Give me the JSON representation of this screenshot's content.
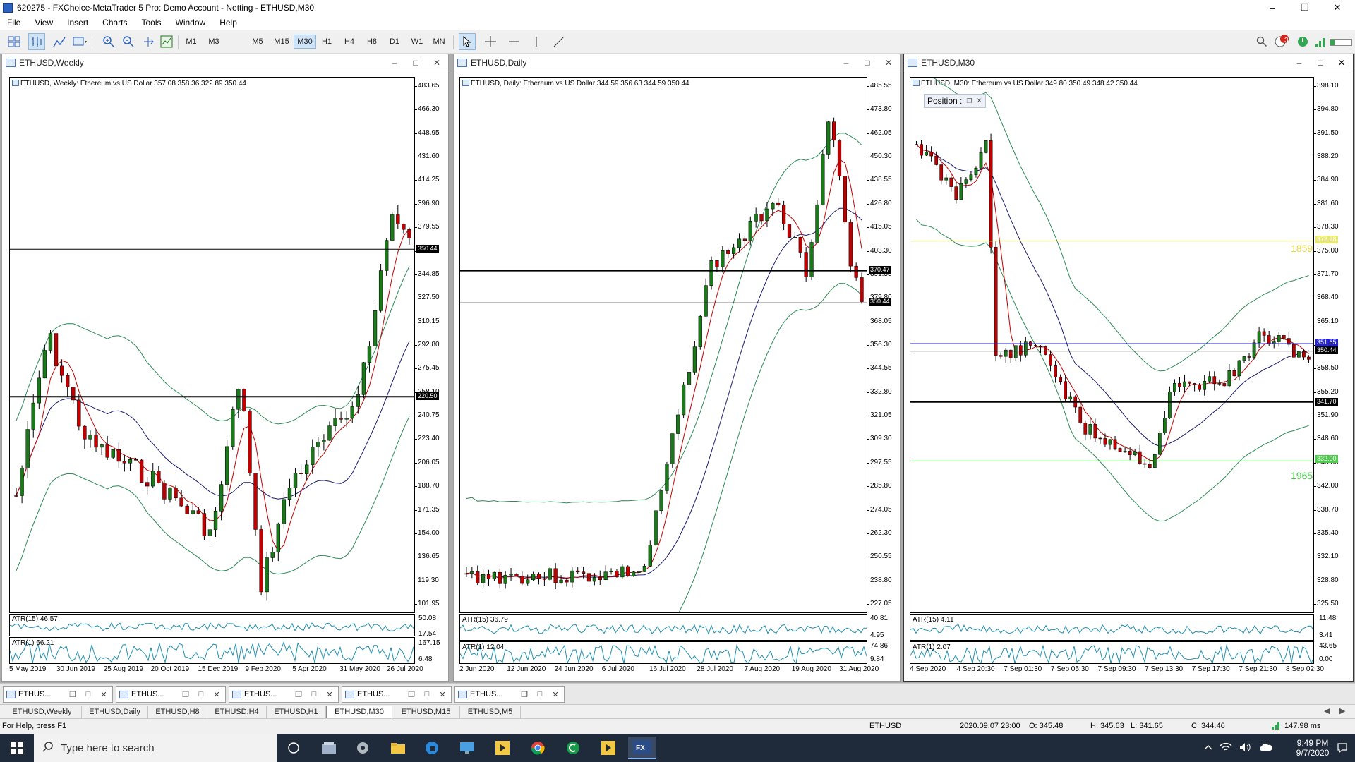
{
  "window": {
    "title": "620275 - FXChoice-MetaTrader 5 Pro: Demo Account - Netting - ETHUSD,M30"
  },
  "menu": [
    "File",
    "View",
    "Insert",
    "Charts",
    "Tools",
    "Window",
    "Help"
  ],
  "timeframes": [
    "M1",
    "M3",
    "M5",
    "M15",
    "M30",
    "H1",
    "H4",
    "H8",
    "D1",
    "W1",
    "MN"
  ],
  "active_timeframe": "M30",
  "notifications": "3",
  "colors": {
    "bull": "#1a7a1a",
    "bear": "#c00000",
    "bands": "#2e8b57",
    "ma_fast": "#c00000",
    "ma_slow": "#1a1a6e"
  },
  "charts": [
    {
      "window_title": "ETHUSD,Weekly",
      "info": "ETHUSD, Weekly:  Ethereum vs US Dollar  357.08 358.36 322.89 350.44",
      "y_ticks": [
        "483.65",
        "466.30",
        "448.95",
        "431.60",
        "414.25",
        "396.90",
        "379.55",
        "362.20",
        "344.85",
        "327.50",
        "310.15",
        "292.80",
        "275.45",
        "258.10",
        "240.75",
        "223.40",
        "206.05",
        "188.70",
        "171.35",
        "154.00",
        "136.65",
        "119.30",
        "101.95"
      ],
      "tags": [
        {
          "text": "350.44",
          "color": "#000"
        },
        {
          "text": "220.50",
          "color": "#000"
        }
      ],
      "atr_a": "ATR(15) 46.57",
      "atr_a_ticks": [
        "50.08",
        "17.54"
      ],
      "atr_b": "ATR(1) 66.21",
      "atr_b_ticks": [
        "167.15",
        "6.48"
      ],
      "x_ticks": [
        "5 May 2019",
        "30 Jun 2019",
        "25 Aug 2019",
        "20 Oct 2019",
        "15 Dec 2019",
        "9 Feb 2020",
        "5 Apr 2020",
        "31 May 2020",
        "26 Jul 2020"
      ]
    },
    {
      "window_title": "ETHUSD,Daily",
      "info": "ETHUSD, Daily:  Ethereum vs US Dollar  344.59 356.63 344.59 350.44",
      "y_ticks": [
        "485.55",
        "473.80",
        "462.05",
        "450.30",
        "438.55",
        "426.80",
        "415.05",
        "403.30",
        "391.55",
        "379.80",
        "368.05",
        "356.30",
        "344.55",
        "332.80",
        "321.05",
        "309.30",
        "297.55",
        "285.80",
        "274.05",
        "262.30",
        "250.55",
        "238.80",
        "227.05"
      ],
      "tags": [
        {
          "text": "370.47",
          "color": "#000"
        },
        {
          "text": "350.44",
          "color": "#000"
        }
      ],
      "atr_a": "ATR(15) 36.79",
      "atr_a_ticks": [
        "40.81",
        "4.95"
      ],
      "atr_b": "ATR(1) 12.04",
      "atr_b_ticks": [
        "74.86",
        "9.84"
      ],
      "x_ticks": [
        "2 Jun 2020",
        "12 Jun 2020",
        "24 Jun 2020",
        "6 Jul 2020",
        "16 Jul 2020",
        "28 Jul 2020",
        "7 Aug 2020",
        "19 Aug 2020",
        "31 Aug 2020"
      ]
    },
    {
      "window_title": "ETHUSD,M30",
      "info": "ETHUSD, M30:  Ethereum vs US Dollar  349.80 350.49 348.42 350.44",
      "position_label": "Position :",
      "y_ticks": [
        "398.10",
        "394.80",
        "391.50",
        "388.20",
        "384.90",
        "381.60",
        "378.30",
        "375.00",
        "371.70",
        "368.40",
        "365.10",
        "361.80",
        "358.50",
        "355.20",
        "351.90",
        "348.60",
        "345.30",
        "342.00",
        "338.70",
        "335.40",
        "332.10",
        "328.80",
        "325.50"
      ],
      "tags": [
        {
          "text": "351.65",
          "color": "#2323c8"
        },
        {
          "text": "350.44",
          "color": "#000"
        },
        {
          "text": "341.70",
          "color": "#000"
        },
        {
          "text": "372.28",
          "color": "#e8e870"
        },
        {
          "text": "332.00",
          "color": "#4ccc4c"
        }
      ],
      "level_labels": [
        {
          "text": "1859",
          "color": "#e8d84a"
        },
        {
          "text": "1965",
          "color": "#4ccc4c"
        }
      ],
      "atr_a": "ATR(15) 4.11",
      "atr_a_ticks": [
        "11.48",
        "3.41"
      ],
      "atr_b": "ATR(1) 2.07",
      "atr_b_ticks": [
        "43.65",
        "0.00"
      ],
      "x_ticks": [
        "4 Sep 2020",
        "4 Sep 20:30",
        "7 Sep 01:30",
        "7 Sep 05:30",
        "7 Sep 09:30",
        "7 Sep 13:30",
        "7 Sep 17:30",
        "7 Sep 21:30",
        "8 Sep 02:30"
      ]
    }
  ],
  "minimized": [
    "ETHUS...",
    "ETHUS...",
    "ETHUS...",
    "ETHUS...",
    "ETHUS..."
  ],
  "chart_tabs": [
    "ETHUSD,Weekly",
    "ETHUSD,Daily",
    "ETHUSD,H8",
    "ETHUSD,H4",
    "ETHUSD,H1",
    "ETHUSD,M30",
    "ETHUSD,M15",
    "ETHUSD,M5"
  ],
  "active_chart_tab": "ETHUSD,M30",
  "status": {
    "help": "For Help, press F1",
    "symbol": "ETHUSD",
    "datetime": "2020.09.07 23:00",
    "open": "O: 345.48",
    "high": "H: 345.63",
    "low": "L: 341.65",
    "close": "C: 344.46",
    "ping": "147.98 ms"
  },
  "taskbar": {
    "search_placeholder": "Type here to search",
    "time": "9:49 PM",
    "date": "9/7/2020"
  }
}
